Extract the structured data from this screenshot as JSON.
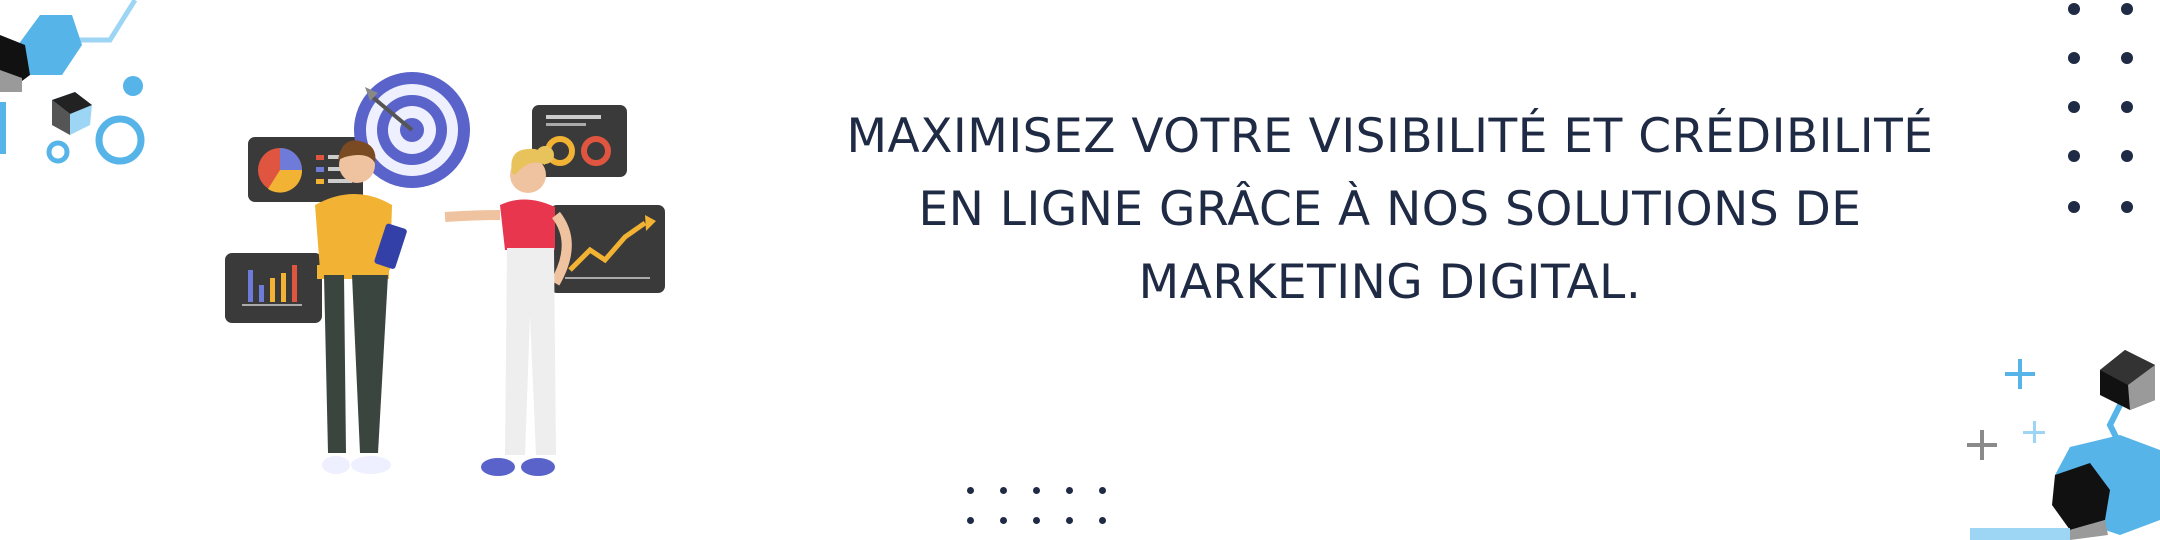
{
  "banner": {
    "headline_lines": [
      "MAXIMISEZ VOTRE VISIBILITÉ ET CRÉDIBILITÉ",
      "EN LIGNE GRÂCE À NOS SOLUTIONS DE",
      "MARKETING DIGITAL."
    ],
    "illustration": "two-people-marketing-analytics-illustration",
    "colors": {
      "text": "#1f2a44",
      "accent_blue": "#56b4e9",
      "light_blue": "#9dd6f5",
      "dark_navy": "#1f2a44",
      "gray": "#8a8a8a"
    }
  }
}
